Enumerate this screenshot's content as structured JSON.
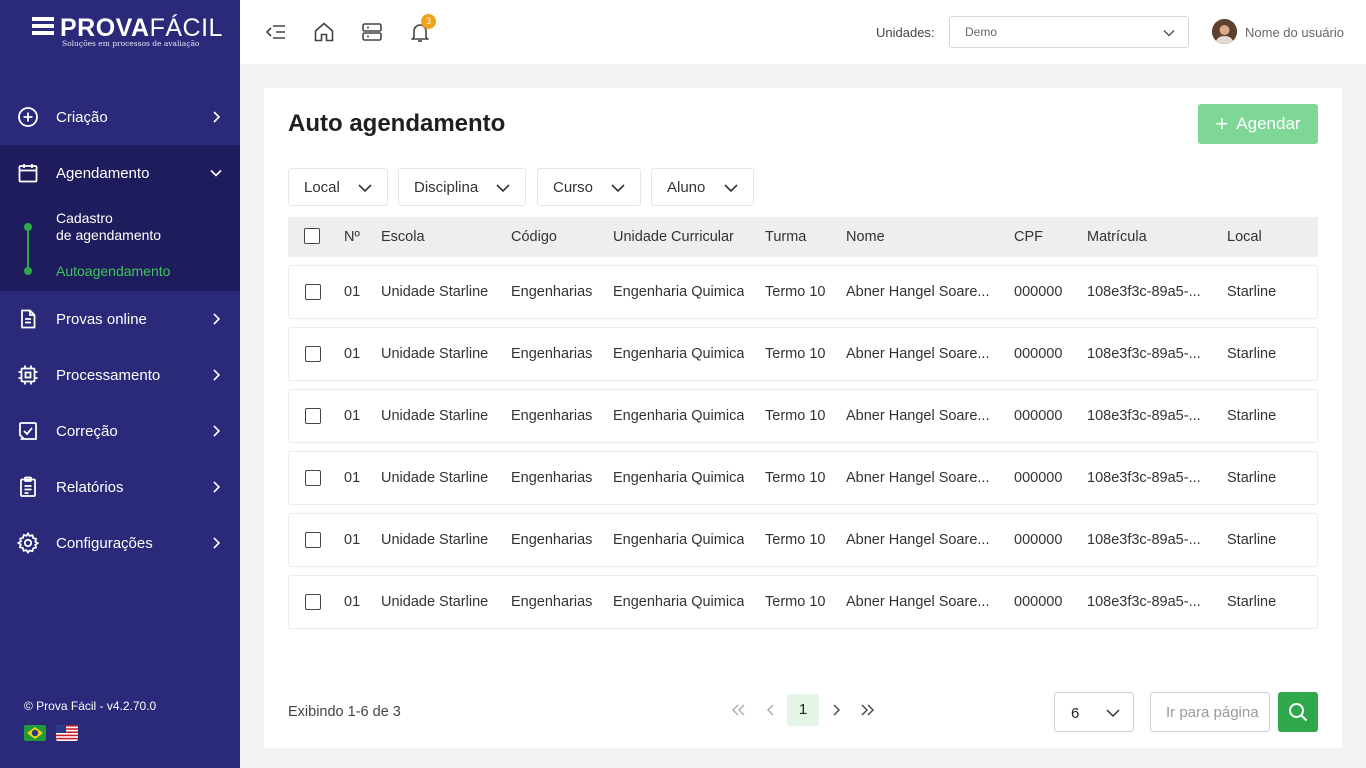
{
  "brand": {
    "name_bold": "PROVA",
    "name_light": "FÁCIL",
    "tagline": "Soluções em processos de avaliação"
  },
  "sidebar": {
    "items": [
      {
        "label": "Criação",
        "icon": "plus-circle-icon"
      },
      {
        "label": "Agendamento",
        "icon": "calendar-icon"
      },
      {
        "label": "Provas online",
        "icon": "document-icon"
      },
      {
        "label": "Processamento",
        "icon": "chip-icon"
      },
      {
        "label": "Correção",
        "icon": "check-square-icon"
      },
      {
        "label": "Relatórios",
        "icon": "clipboard-icon"
      },
      {
        "label": "Configurações",
        "icon": "gear-icon"
      }
    ],
    "subitems": [
      {
        "label_line1": "Cadastro",
        "label_line2": "de agendamento"
      },
      {
        "label": "Autoagendamento"
      }
    ],
    "version": "© Prova Fácil - v4.2.70.0",
    "languages": [
      "brazil-flag-icon",
      "usa-flag-icon"
    ]
  },
  "header": {
    "notification_count": "3",
    "unidades_label": "Unidades:",
    "unidades_value": "Demo",
    "username": "Nome do usuário"
  },
  "main": {
    "title": "Auto agendamento",
    "add_button": "Agendar",
    "filters": [
      "Local",
      "Disciplina",
      "Curso",
      "Aluno"
    ],
    "columns": [
      "Nº",
      "Escola",
      "Código",
      "Unidade Curricular",
      "Turma",
      "Nome",
      "CPF",
      "Matrícula",
      "Local"
    ],
    "rows": [
      [
        "01",
        "Unidade Starline",
        "Engenharias",
        "Engenharia Quimica",
        "Termo 10",
        "Abner Hangel Soare...",
        "000000",
        "108e3f3c-89a5-...",
        "Starline"
      ],
      [
        "01",
        "Unidade Starline",
        "Engenharias",
        "Engenharia Quimica",
        "Termo 10",
        "Abner Hangel Soare...",
        "000000",
        "108e3f3c-89a5-...",
        "Starline"
      ],
      [
        "01",
        "Unidade Starline",
        "Engenharias",
        "Engenharia Quimica",
        "Termo 10",
        "Abner Hangel Soare...",
        "000000",
        "108e3f3c-89a5-...",
        "Starline"
      ],
      [
        "01",
        "Unidade Starline",
        "Engenharias",
        "Engenharia Quimica",
        "Termo 10",
        "Abner Hangel Soare...",
        "000000",
        "108e3f3c-89a5-...",
        "Starline"
      ],
      [
        "01",
        "Unidade Starline",
        "Engenharias",
        "Engenharia Quimica",
        "Termo 10",
        "Abner Hangel Soare...",
        "000000",
        "108e3f3c-89a5-...",
        "Starline"
      ],
      [
        "01",
        "Unidade Starline",
        "Engenharias",
        "Engenharia Quimica",
        "Termo 10",
        "Abner Hangel Soare...",
        "000000",
        "108e3f3c-89a5-...",
        "Starline"
      ]
    ]
  },
  "pagination": {
    "info": "Exibindo 1-6 de 3",
    "current_page": "1",
    "per_page": "6",
    "goto_placeholder": "Ir para página"
  },
  "colors": {
    "sidebar": "#2b2a7a",
    "sidebar_active": "#1e1c5c",
    "accent_green": "#2ea84a",
    "button_light_green": "#7ed796",
    "badge": "#f0a21b"
  }
}
